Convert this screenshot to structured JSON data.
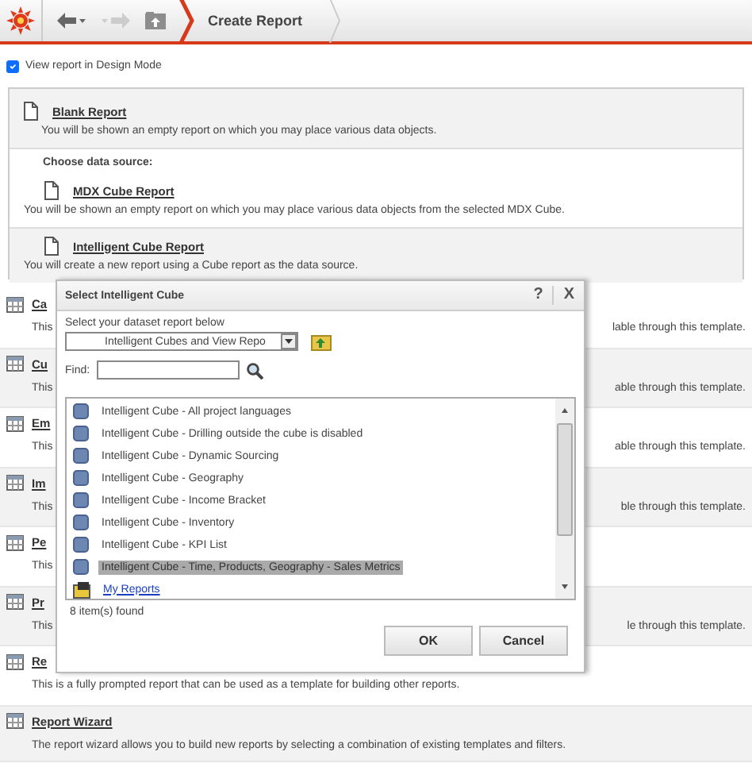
{
  "toolbar": {
    "back_enabled": true,
    "forward_enabled": false,
    "breadcrumb": "Create Report"
  },
  "design_mode": {
    "label": "View report in Design Mode",
    "checked": true
  },
  "blank_report": {
    "title": "Blank Report",
    "description": "You will be shown an empty report on which you may place various data objects."
  },
  "data_source": {
    "heading": "Choose data source:",
    "options": [
      {
        "title": "MDX Cube Report",
        "description": "You will be shown an empty report on which you may place various data objects from the selected MDX Cube."
      },
      {
        "title": "Intelligent Cube Report",
        "description": "You will create a new report using a Cube report as the data source."
      }
    ]
  },
  "templates": [
    {
      "title": "Ca",
      "description": "This",
      "description_end": "lable through this template."
    },
    {
      "title": "Cu",
      "description": "This",
      "description_end": "able through this template."
    },
    {
      "title": "Em",
      "description": "This",
      "description_end": "able through this template."
    },
    {
      "title": "Im",
      "description": "This",
      "description_end": "ble through this template."
    },
    {
      "title": "Pe",
      "description": "This"
    },
    {
      "title": "Pr",
      "description": "This",
      "description_end": "le through this template."
    },
    {
      "title": "Re",
      "description": "This is a fully prompted report that can be used as a template for building other reports."
    },
    {
      "title": "Report Wizard",
      "description": "The report wizard allows you to build new reports by selecting a combination of existing templates and filters."
    }
  ],
  "dialog": {
    "title": "Select Intelligent Cube",
    "help": "?",
    "close": "X",
    "prompt": "Select your dataset report below",
    "dropdown_value": "Intelligent Cubes and View Repo",
    "find_label": "Find:",
    "items": [
      {
        "kind": "cube",
        "label": "Intelligent Cube - All project languages",
        "selected": false
      },
      {
        "kind": "cube",
        "label": "Intelligent Cube - Drilling outside the cube is disabled",
        "selected": false
      },
      {
        "kind": "cube",
        "label": "Intelligent Cube - Dynamic Sourcing",
        "selected": false
      },
      {
        "kind": "cube",
        "label": "Intelligent Cube - Geography",
        "selected": false
      },
      {
        "kind": "cube",
        "label": "Intelligent Cube - Income Bracket",
        "selected": false
      },
      {
        "kind": "cube",
        "label": "Intelligent Cube - Inventory",
        "selected": false
      },
      {
        "kind": "cube",
        "label": "Intelligent Cube - KPI List",
        "selected": false
      },
      {
        "kind": "cube",
        "label": "Intelligent Cube - Time, Products, Geography - Sales Metrics",
        "selected": true
      },
      {
        "kind": "folder",
        "label": "My Reports",
        "selected": false
      }
    ],
    "count": "8 item(s) found",
    "buttons": [
      "OK",
      "Cancel"
    ]
  }
}
